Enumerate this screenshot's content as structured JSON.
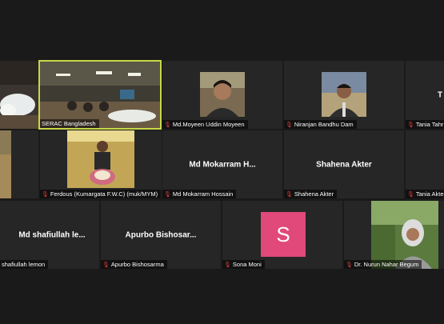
{
  "colors": {
    "background": "#1a1a1a",
    "tile": "#262626",
    "active_border": "#c8d848",
    "avatar_pink": "#e1497a",
    "muted_icon": "#e03c3c"
  },
  "row1": [
    {
      "name": ""
    },
    {
      "name": "SERAC Bangladesh",
      "muted": false
    },
    {
      "name": "Md.Moyeen Uddin Moyeen",
      "muted": true
    },
    {
      "name": "Niranjan Bandhu Dam",
      "muted": true
    },
    {
      "name": "Tania Tahr",
      "muted": true,
      "title": "T"
    }
  ],
  "row2": [
    {
      "name": ""
    },
    {
      "name": "Ferdous (Kumargata F.W.C) (muk/MYM)",
      "muted": true
    },
    {
      "name": "Md Mokarram Hossain",
      "muted": true,
      "title": "Md Mokarram H..."
    },
    {
      "name": "Shahena Akter",
      "muted": true,
      "title": "Shahena Akter"
    },
    {
      "name": "Tania Akte",
      "muted": true
    }
  ],
  "row3": [
    {
      "name": "shafiullah lemon",
      "muted": false,
      "title": "Md shafiullah le..."
    },
    {
      "name": "Apurbo Bishosarma",
      "muted": true,
      "title": "Apurbo Bishosar..."
    },
    {
      "name": "Sona Moni",
      "muted": true,
      "avatar_letter": "S"
    },
    {
      "name": "Dr. Nurun Nahar Begum",
      "muted": true
    }
  ],
  "icons": {
    "muted_mic": "muted-mic-icon"
  }
}
